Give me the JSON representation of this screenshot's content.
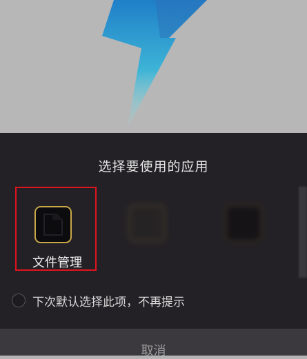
{
  "chooser": {
    "title": "选择要使用的应用",
    "apps": [
      {
        "label": "文件管理",
        "selected": true
      },
      {
        "label": "",
        "blurred": true
      },
      {
        "label": "",
        "blurred": true
      }
    ],
    "remember_label": "下次默认选择此项，不再提示",
    "cancel_label": "取消"
  },
  "colors": {
    "selection_border": "#e0141e",
    "sheet_background": "#232125",
    "icon_border": "#c9a84a",
    "lightning_top": "#1f7fc8",
    "lightning_bottom": "#4fd6d6"
  },
  "icons": {
    "backdrop": "lightning-bolt-icon",
    "file_manager": "folder-icon"
  }
}
